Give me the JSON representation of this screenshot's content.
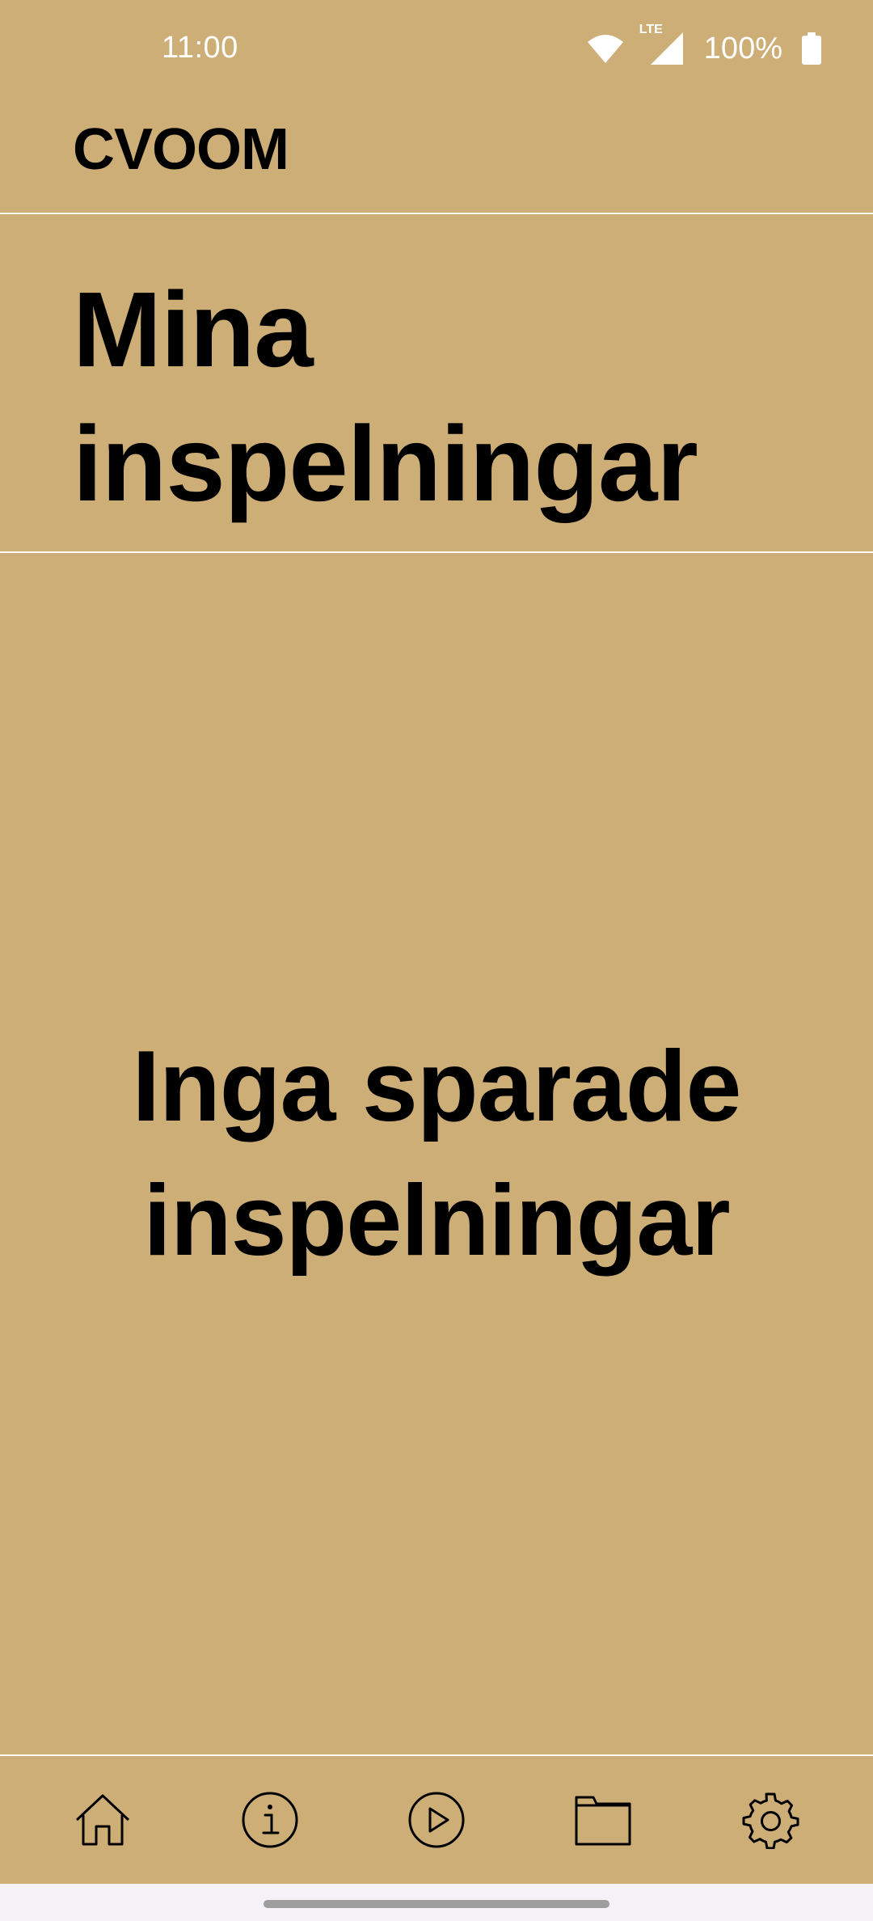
{
  "status_bar": {
    "time": "11:00",
    "network_label": "LTE",
    "battery_percent": "100%",
    "icons": [
      "wifi-icon",
      "signal-icon",
      "battery-icon"
    ]
  },
  "header": {
    "app_name": "CVOOM"
  },
  "page": {
    "title": "Mina inspelningar",
    "empty_message": "Inga sparade inspelningar"
  },
  "bottom_nav": {
    "items": [
      {
        "icon": "home-icon"
      },
      {
        "icon": "info-icon"
      },
      {
        "icon": "play-icon"
      },
      {
        "icon": "folder-icon"
      },
      {
        "icon": "gear-icon"
      }
    ]
  },
  "colors": {
    "background": "#CDAE77",
    "divider": "#FFFFFF",
    "text": "#000000",
    "status_text": "#FFFFFF",
    "gesture_area": "#F4F2F6"
  }
}
